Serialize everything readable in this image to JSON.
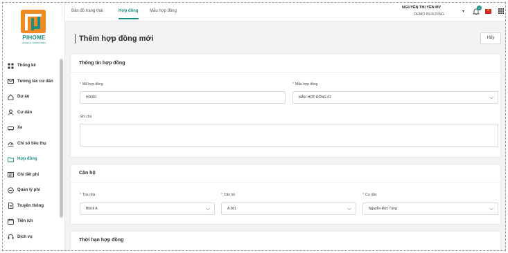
{
  "brand": {
    "logo_text": "PIHOME",
    "logo_sub": "HOMES & TOWNHOMES",
    "color": "#1a8f86"
  },
  "sidebar": {
    "items": [
      {
        "label": "Thống kê",
        "icon": "grid-icon",
        "active": false
      },
      {
        "label": "Tương tác cư dân",
        "icon": "mail-icon",
        "active": false
      },
      {
        "label": "Dự án",
        "icon": "home-icon",
        "active": false
      },
      {
        "label": "Cư dân",
        "icon": "user-icon",
        "active": false
      },
      {
        "label": "Xe",
        "icon": "car-icon",
        "active": false
      },
      {
        "label": "Chỉ số tiêu thụ",
        "icon": "meter-icon",
        "active": false
      },
      {
        "label": "Hợp đồng",
        "icon": "folder-icon",
        "active": true
      },
      {
        "label": "Chi tiết phí",
        "icon": "invoice-icon",
        "active": false
      },
      {
        "label": "Quản lý phí",
        "icon": "coin-icon",
        "active": false
      },
      {
        "label": "Truyền thông",
        "icon": "document-icon",
        "active": false
      },
      {
        "label": "Tiện ích",
        "icon": "calendar-icon",
        "active": false
      },
      {
        "label": "Dịch vụ",
        "icon": "headset-icon",
        "active": false
      }
    ]
  },
  "topbar": {
    "tabs": [
      {
        "label": "Bản đồ trạng thái",
        "active": false
      },
      {
        "label": "Hợp đồng",
        "active": true
      },
      {
        "label": "Mẫu hợp đồng",
        "active": false
      }
    ],
    "user_name": "NGUYỄN THỊ YẾN MY",
    "building": "DEMO BUILDING",
    "notification_count": "0"
  },
  "page": {
    "title": "Thêm hợp đồng mới",
    "cancel_label": "Hủy"
  },
  "contract_info": {
    "title": "Thông tin hợp đồng",
    "code": {
      "label": "Mã hợp đồng",
      "value": "HD001"
    },
    "template": {
      "label": "Mẫu hợp đồng",
      "value": "MẪU HỢP ĐỒNG 02"
    },
    "note": {
      "label": "Ghi chú",
      "value": ""
    }
  },
  "apartment": {
    "title": "Căn hộ",
    "building": {
      "label": "Tòa nhà",
      "value": "Block A"
    },
    "unit": {
      "label": "Căn hộ",
      "value": "A.001"
    },
    "resident": {
      "label": "Cư dân",
      "value": "Nguyễn Đức Tùng"
    }
  },
  "term": {
    "title": "Thời hạn hợp đồng"
  }
}
